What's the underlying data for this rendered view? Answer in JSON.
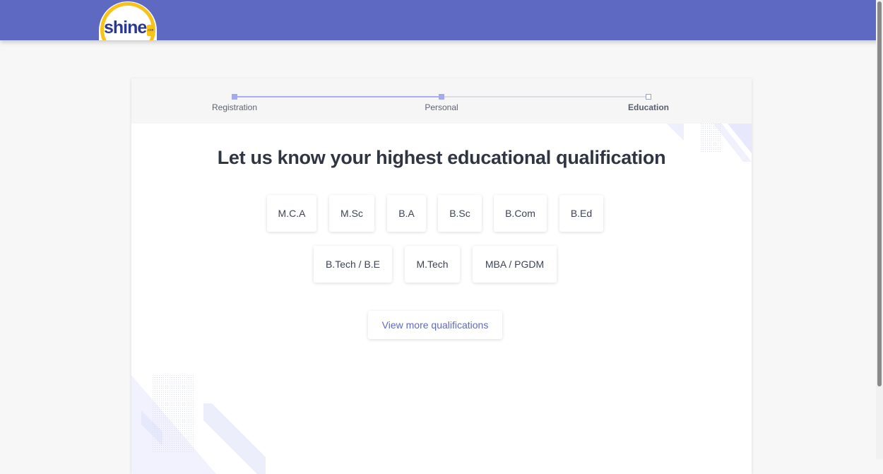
{
  "brand": {
    "logo_text": "shine",
    "logo_suffix": ".com",
    "colors": {
      "header": "#5e6ac2",
      "logo_blue": "#2b3a8c",
      "logo_yellow": "#f7c31a",
      "accent": "#5e6ac2"
    }
  },
  "stepper": {
    "steps": [
      {
        "label": "Registration",
        "state": "done"
      },
      {
        "label": "Personal",
        "state": "done"
      },
      {
        "label": "Education",
        "state": "current"
      }
    ]
  },
  "main": {
    "heading": "Let us know your highest educational qualification",
    "qualifications_row1": [
      "M.C.A",
      "M.Sc",
      "B.A",
      "B.Sc",
      "B.Com",
      "B.Ed"
    ],
    "qualifications_row2": [
      "B.Tech / B.E",
      "M.Tech",
      "MBA / PGDM"
    ],
    "view_more_label": "View more qualifications"
  }
}
